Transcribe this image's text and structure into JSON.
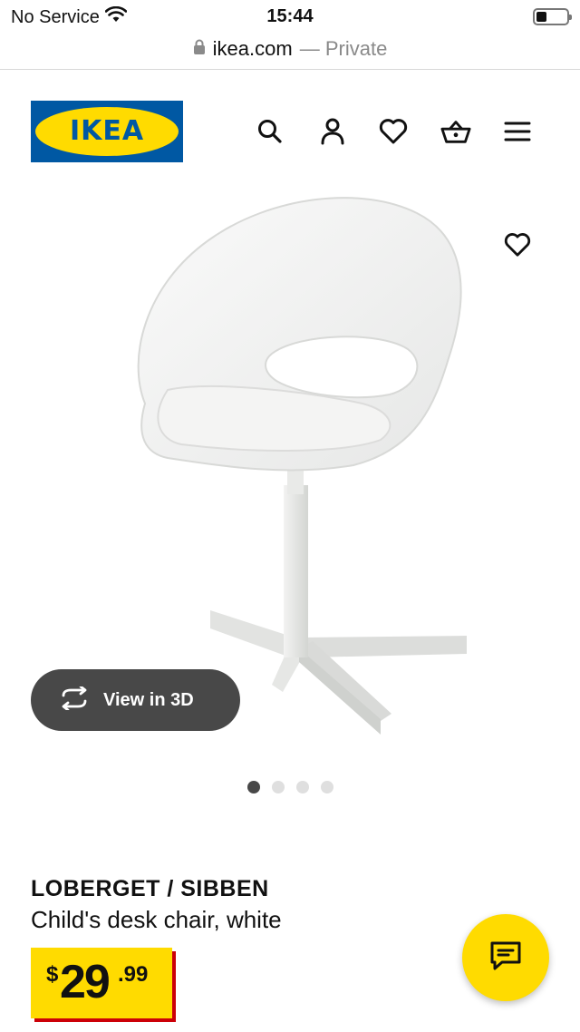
{
  "status_bar": {
    "carrier": "No Service",
    "time": "15:44",
    "wifi_icon": "wifi-icon",
    "battery_level": 0.35
  },
  "browser": {
    "domain": "ikea.com",
    "private_label": "— Private",
    "lock_icon": "lock-icon"
  },
  "header": {
    "logo_text": "IKEA",
    "icons": [
      "search-icon",
      "user-icon",
      "heart-icon",
      "basket-icon",
      "menu-icon"
    ]
  },
  "gallery": {
    "view_3d_label": "View in 3D",
    "slide_count": 4,
    "active_slide": 1,
    "colors": {
      "button": "#484848",
      "dot_inactive": "#dfdfdf",
      "dot_active": "#484848"
    }
  },
  "product": {
    "name": "LOBERGET / SIBBEN",
    "description": "Child's desk chair, white",
    "price": {
      "currency": "$",
      "whole": "29",
      "decimal": ".99"
    }
  },
  "colors": {
    "ikea_blue": "#0058a3",
    "ikea_yellow": "#ffdb00",
    "price_shadow": "#cc0008"
  }
}
